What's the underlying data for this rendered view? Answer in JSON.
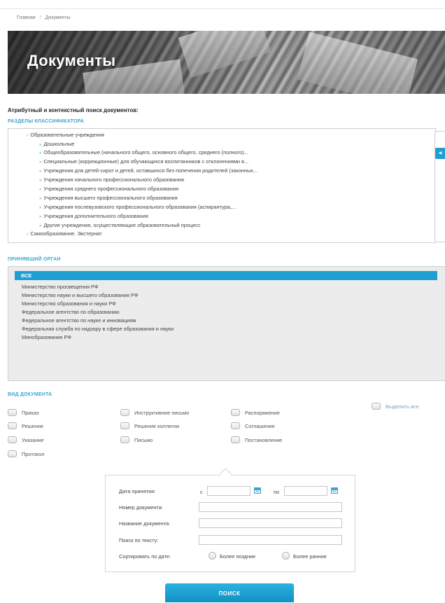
{
  "breadcrumb": {
    "home": "Главная",
    "separator": "/",
    "current": "Документы"
  },
  "hero": {
    "title": "Документы"
  },
  "search_title": "Атрибутный и контекстный поиск документов:",
  "classifier": {
    "label": "РАЗДЕЛЫ КЛАССИФИКАТОРА",
    "items": [
      {
        "text": "Образовательные учреждения",
        "level": 0
      },
      {
        "text": "Дошкольные",
        "level": 1
      },
      {
        "text": "Общеобразовательные (начального общего, основного общего, среднего (полного)...",
        "level": 1
      },
      {
        "text": "Специальные (коррекционные) для обучающихся воспитанников с отклонениями в...",
        "level": 1
      },
      {
        "text": "Учреждения для детей-сирот и детей, оставшихся без попечения родителей (законных...",
        "level": 1
      },
      {
        "text": "Учреждения начального профессионального образования",
        "level": 1
      },
      {
        "text": "Учреждения среднего профессионального образования",
        "level": 1
      },
      {
        "text": "Учреждения высшего профессионального образования",
        "level": 1
      },
      {
        "text": "Учреждения послевузовского профессионального образования (аспирантура,...",
        "level": 1
      },
      {
        "text": "Учреждения дополнительного образования",
        "level": 1
      },
      {
        "text": "Другие учреждения, осуществляющие образовательный процесс",
        "level": 1
      },
      {
        "text": "Самообразование. Экстернат",
        "level": 0
      }
    ]
  },
  "organ": {
    "label": "ПРИНЯВШИЙ ОРГАН",
    "selected": "ВСЕ",
    "items": [
      "Министерство просвещения РФ",
      "Министерство науки и высшего образования РФ",
      "Министерство образования и науки РФ",
      "Федеральное агентство по образованию",
      "Федеральное агентство по науке и инновациям",
      "Федеральная служба по надзору в сфере образования и науки",
      "Минобразования РФ"
    ]
  },
  "doc_type": {
    "label": "ВИД ДОКУМЕНТА",
    "select_all": "Выделить все",
    "options": [
      "Приказ",
      "Инструктивное письмо",
      "Распоряжение",
      "Решение",
      "Решение коллегии",
      "Соглашение",
      "Указание",
      "Письмо",
      "Постановление",
      "Протокол"
    ]
  },
  "form": {
    "date_label": "Дата принятия:",
    "from_label": "с",
    "to_label": "по",
    "number_label": "Номер документа:",
    "name_label": "Название документа:",
    "text_label": "Поиск по тексту:",
    "sort_label": "Сортировать по дате:",
    "sort_later": "Более поздние",
    "sort_earlier": "Более ранние"
  },
  "search_button": "ПОИСК",
  "colors": {
    "accent": "#1f9fd1",
    "label": "#3aa6cf"
  }
}
